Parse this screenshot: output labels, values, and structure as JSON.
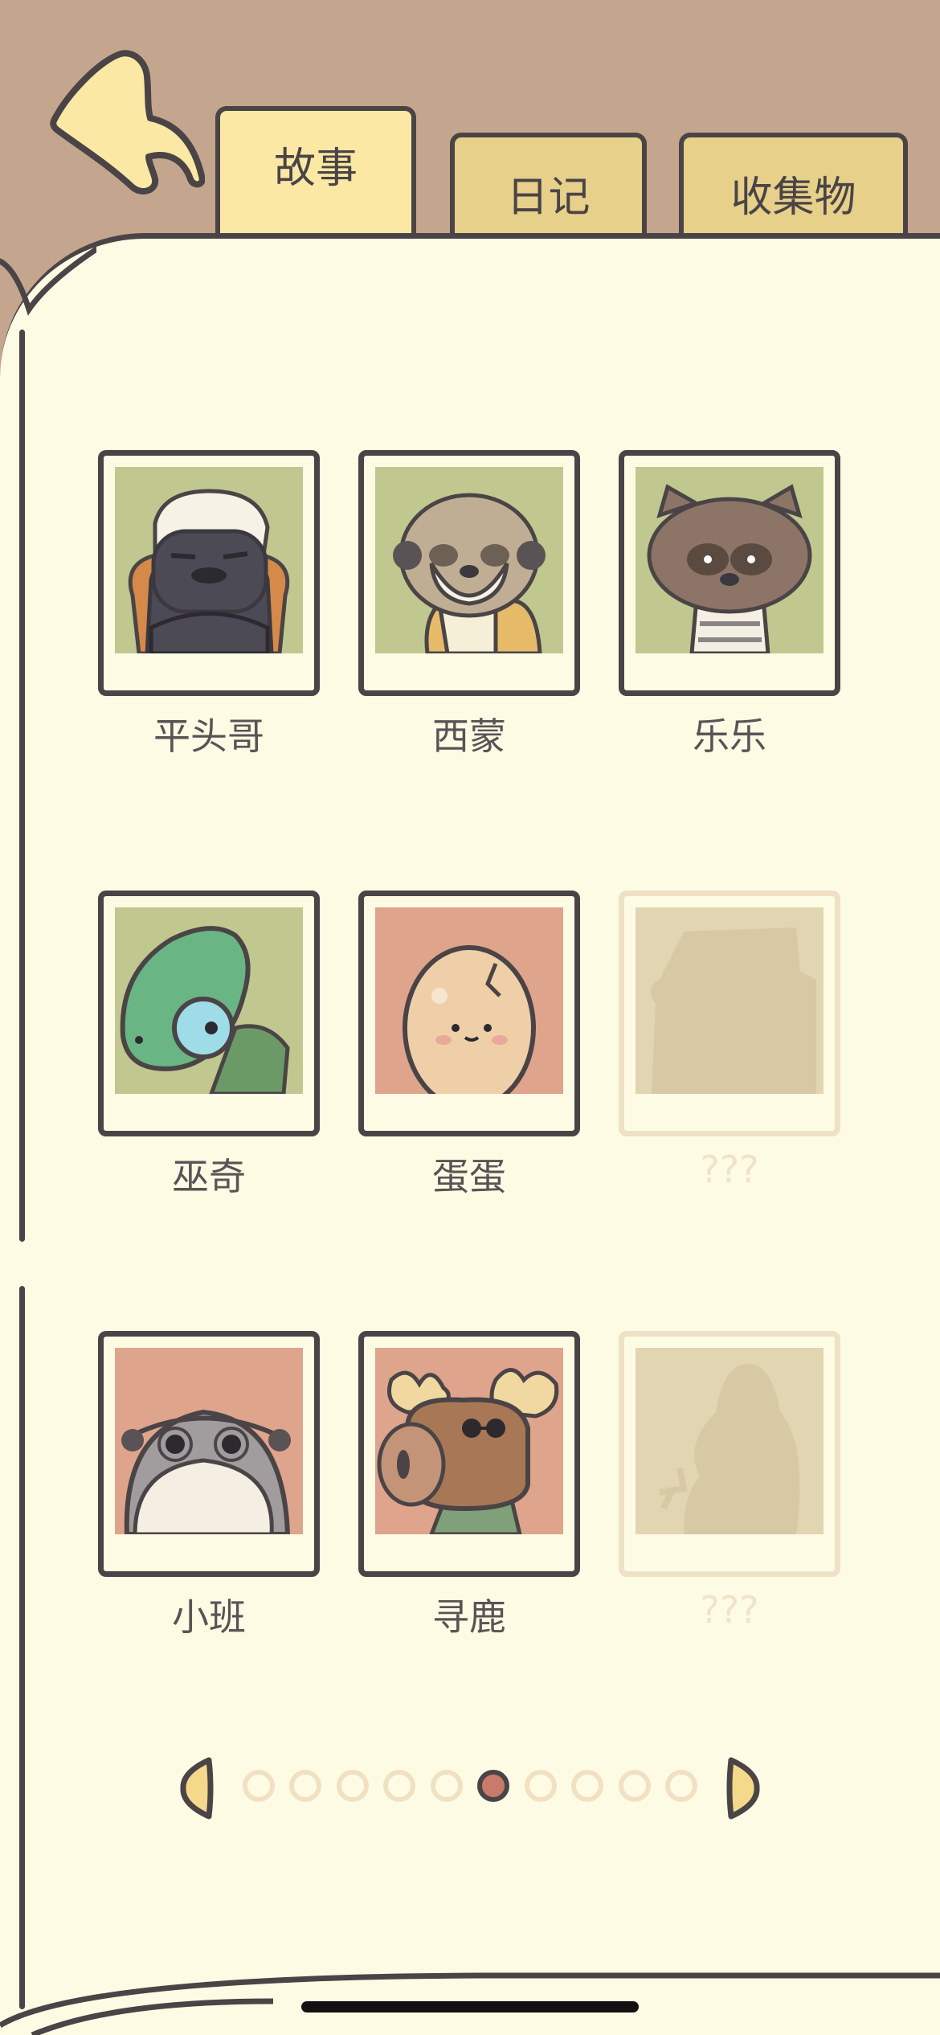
{
  "tabs": [
    {
      "label": "故事",
      "active": true
    },
    {
      "label": "日记",
      "active": false
    },
    {
      "label": "收集物",
      "active": false
    }
  ],
  "characters": [
    {
      "name": "平头哥",
      "locked": false,
      "bg": "#c0c88f",
      "icon": "honey-badger-portrait"
    },
    {
      "name": "西蒙",
      "locked": false,
      "bg": "#c0c88f",
      "icon": "meerkat-portrait"
    },
    {
      "name": "乐乐",
      "locked": false,
      "bg": "#c0c88f",
      "icon": "raccoon-dog-portrait"
    },
    {
      "name": "巫奇",
      "locked": false,
      "bg": "#c0c88f",
      "icon": "chameleon-portrait"
    },
    {
      "name": "蛋蛋",
      "locked": false,
      "bg": "#dfa48c",
      "icon": "potato-egg-portrait"
    },
    {
      "name": "???",
      "locked": true,
      "bg": "#e2d5b2",
      "icon": "locked-silhouette"
    },
    {
      "name": "小班",
      "locked": false,
      "bg": "#dfa48c",
      "icon": "otter-portrait"
    },
    {
      "name": "寻鹿",
      "locked": false,
      "bg": "#dfa48c",
      "icon": "moose-portrait"
    },
    {
      "name": "???",
      "locked": true,
      "bg": "#e2d5b2",
      "icon": "locked-silhouette"
    }
  ],
  "pagination": {
    "total_pages": 10,
    "current_page": 6
  },
  "colors": {
    "header_bg": "#c4a58e",
    "page_bg": "#fefbe5",
    "outline": "#4a4446",
    "tab_active": "#fbe8a4",
    "tab_inactive": "#e6d08a",
    "active_dot": "#c87b6a"
  }
}
